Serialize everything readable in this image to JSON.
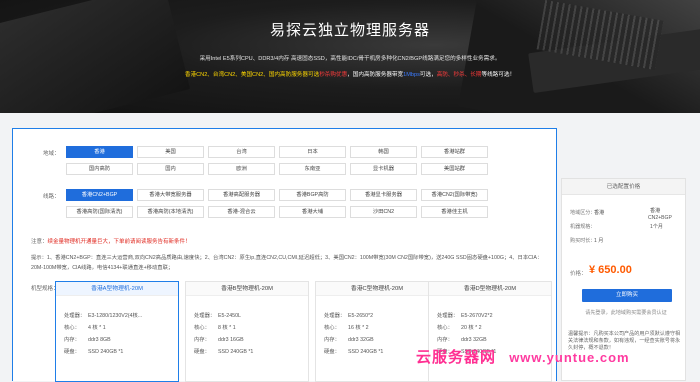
{
  "hero": {
    "title": "易探云独立物理服务器",
    "desc": "采用Intel E5系列CPU、DDR3/4内存 高速固态SSD，高性能IDC/骨干机房多种化CN2/BGP线路满足您的多样性业务需求。",
    "line_parts": [
      "香港CN2、台湾CN2、美国CN2、国内高防服务器可选",
      "秒杀购优惠",
      "，国内高防服务器带宽",
      "1Mbps",
      "可选，",
      "高防、秒杀、长期",
      "等线路可选！"
    ],
    "line_colors": [
      "#ffd800",
      "#ff3b3b",
      "#ffffff",
      "#3b7bff",
      "#ffffff",
      "#ff3b3b",
      "#ffffff"
    ]
  },
  "region": {
    "label": "地域：",
    "options": [
      "香港",
      "美国",
      "台湾",
      "日本",
      "韩国",
      "香港站群",
      "国内高防",
      "国内",
      "欧洲",
      "东南亚",
      "显卡机器",
      "美国站群"
    ],
    "selected": 0
  },
  "line": {
    "label": "线路：",
    "options": [
      "香港CN2+BGP",
      "香港大带宽服务器",
      "香港高配服务器",
      "香港BGP高防",
      "香港显卡服务器",
      "香港CN2(国际带宽)",
      "香港高防(国际清洗)",
      "香港高防(本地清洗)",
      "香港-混合云",
      "香港大埔",
      "沙田CN2",
      "香港佳主机"
    ],
    "selected": 0
  },
  "notice": {
    "label": "注意：",
    "text": "续金量物理机开通量巨大，下单前请阅读服务告有新条件！"
  },
  "tips": {
    "label": "提示：",
    "text": "1、香港CN2+BGP：直连三大运营商,双向CN2高品质路由,速度快；2、台湾CN2：原生ip,直连CN2,CU,CMI,延迟超低；3、美国CN2：100M带宽(30M CN2国际带宽)，送240G SSD固态硬盘+100G；4、日本CIA：20M-100M带宽，CIA线路，电信4134+联通直连+移动直联；"
  },
  "machine_label": "机型规格：",
  "spec_keys": [
    "处理器：",
    "核心：",
    "内存：",
    "硬盘："
  ],
  "cards": [
    {
      "title": "香港A型物理机-20M",
      "cpu": "E3-1280/1230V2(4核...",
      "cores": "4 核 * 1",
      "ram": "ddr3 8GB",
      "disk": "SSD 240GB *1"
    },
    {
      "title": "香港B型物理机-20M",
      "cpu": "E5-2450L",
      "cores": "8 核 * 1",
      "ram": "ddr3 16GB",
      "disk": "SSD 240GB *1"
    },
    {
      "title": "香港C型物理机-20M",
      "cpu": "E5-2650*2",
      "cores": "16 核 * 2",
      "ram": "ddr3 32GB",
      "disk": "SSD 240GB *1"
    },
    {
      "title": "香港D型物理机-20M",
      "cpu": "E5-2670V2*2",
      "cores": "20 核 * 2",
      "ram": "ddr3 32GB",
      "disk": "SSD 240GB *1"
    }
  ],
  "sidebar": {
    "header": "已选配置价格",
    "rows": [
      {
        "k": "地域区分：",
        "v": "香港"
      },
      {
        "k": "线路：",
        "v": "香港CN2+BGP"
      },
      {
        "k": "机器规格：",
        "v": "香港A型物理机-20M"
      },
      {
        "k": "购买时长：",
        "v": "1 月"
      }
    ],
    "line_value_extra": "CN2+BGP",
    "line_sub": "1个月",
    "price_label": "价格：",
    "price": "¥ 650.00",
    "buy": "立即购买",
    "note": "请先登录，此地域购买需要会员认证",
    "warn": "温馨提示：凡购买本公司产品的用户须默认遵守相关法律法规和条款，如有违规，一经查实账号将永久封停，概不退款！"
  },
  "watermark": {
    "cn": "云服务器网",
    "url": "www.yuntue.com"
  }
}
